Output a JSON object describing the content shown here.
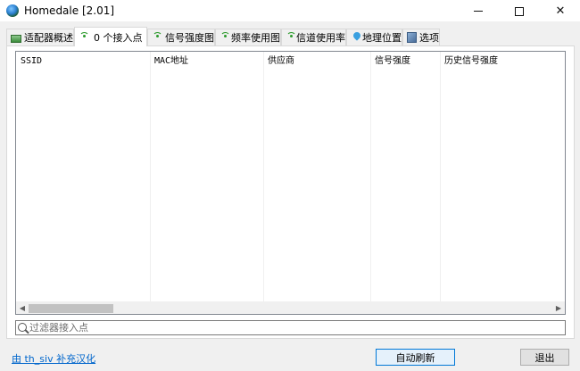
{
  "window": {
    "title": "Homedale [2.01]",
    "controls": {
      "minimize": "",
      "maximize": "",
      "close": "✕"
    }
  },
  "tabs": [
    {
      "label": "适配器概述",
      "icon": "adapter-icon",
      "active": false
    },
    {
      "label": "0 个接入点",
      "icon": "wifi-icon",
      "active": true
    },
    {
      "label": "信号强度图",
      "icon": "wifi-icon",
      "active": false
    },
    {
      "label": "频率使用图",
      "icon": "wifi-icon",
      "active": false
    },
    {
      "label": "信道使用率",
      "icon": "wifi-icon",
      "active": false
    },
    {
      "label": "地理位置",
      "icon": "map-pin-icon",
      "active": false
    },
    {
      "label": "选项",
      "icon": "options-icon",
      "active": false
    }
  ],
  "list": {
    "columns": [
      "SSID",
      "MAC地址",
      "供应商",
      "信号强度",
      "历史信号强度"
    ],
    "sort_indicator": "^",
    "scroll_left": "◀",
    "scroll_right": "▶"
  },
  "filter": {
    "placeholder": "过滤器接入点",
    "value": ""
  },
  "footer": {
    "credit": "由 th_siv 补充汉化",
    "refresh_label": "自动刷新",
    "exit_label": "退出"
  },
  "colors": {
    "accent": "#0078d7",
    "link": "#0066cc",
    "wifi_icon": "#2b9a2b"
  }
}
